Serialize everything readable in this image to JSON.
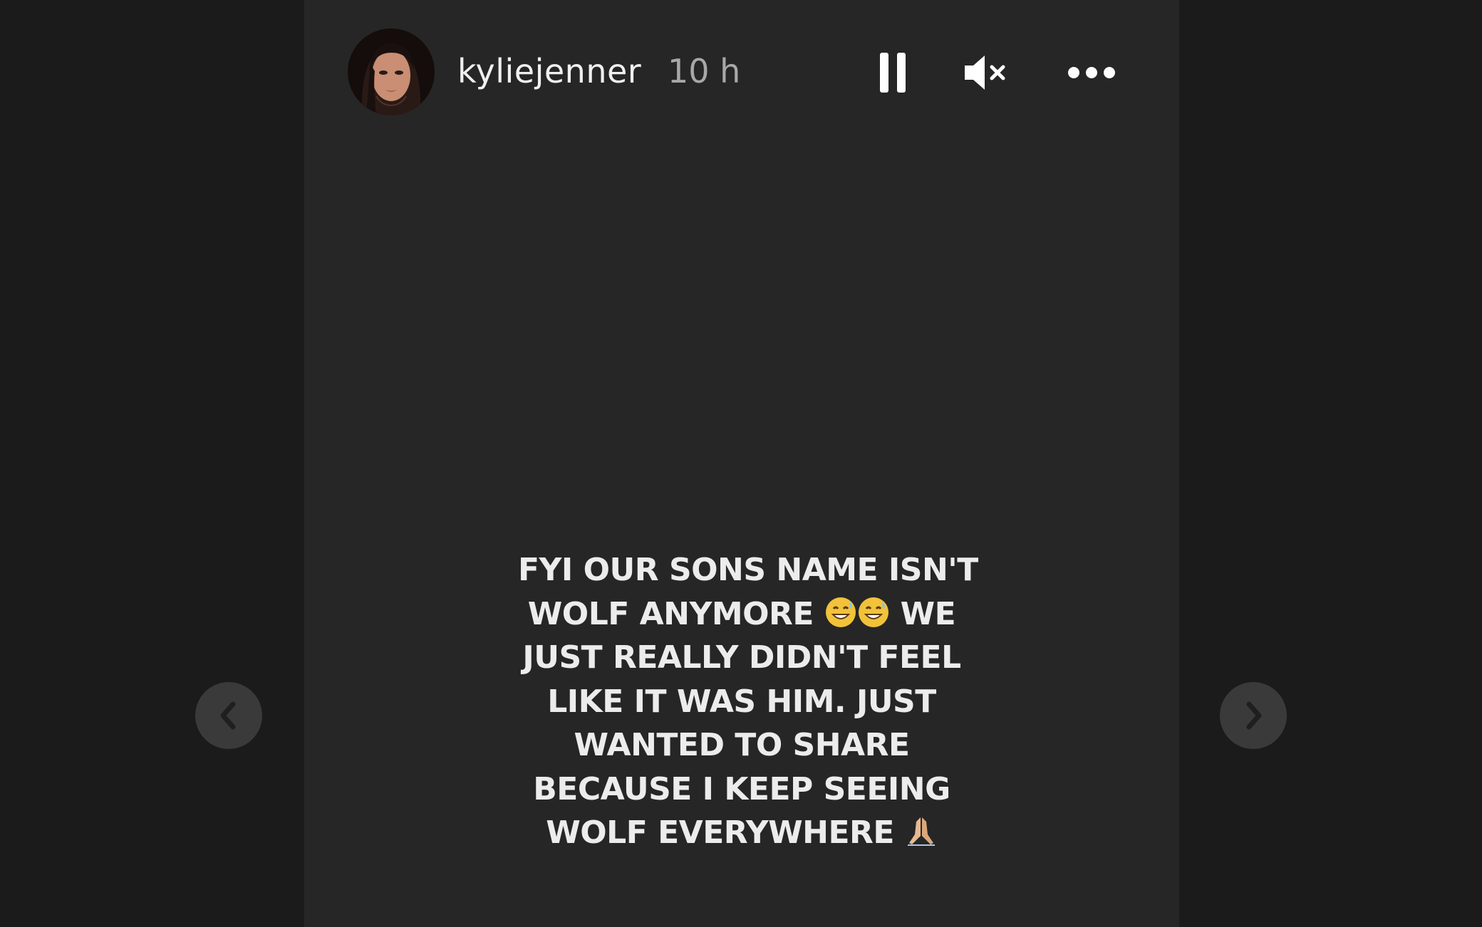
{
  "story": {
    "username": "kyliejenner",
    "timestamp": "10 h",
    "text_lines": [
      "FYI OUR SONS NAME ISN'T",
      "WOLF ANYMORE",
      "WE",
      "JUST REALLY DIDN'T FEEL",
      "LIKE IT WAS HIM. JUST",
      "WANTED TO SHARE",
      "BECAUSE I KEEP SEEING",
      "WOLF EVERYWHERE"
    ]
  },
  "controls": {
    "pause_icon": "pause-icon",
    "mute_icon": "muted-speaker-icon",
    "more_icon": "more-options-icon"
  },
  "navigation": {
    "prev_icon": "chevron-left-icon",
    "next_icon": "chevron-right-icon"
  },
  "colors": {
    "background": "#1b1b1b",
    "story_background": "#262626",
    "text": "#ececec",
    "timestamp": "#a8a8a8",
    "nav_button": "#3a3a3a"
  }
}
